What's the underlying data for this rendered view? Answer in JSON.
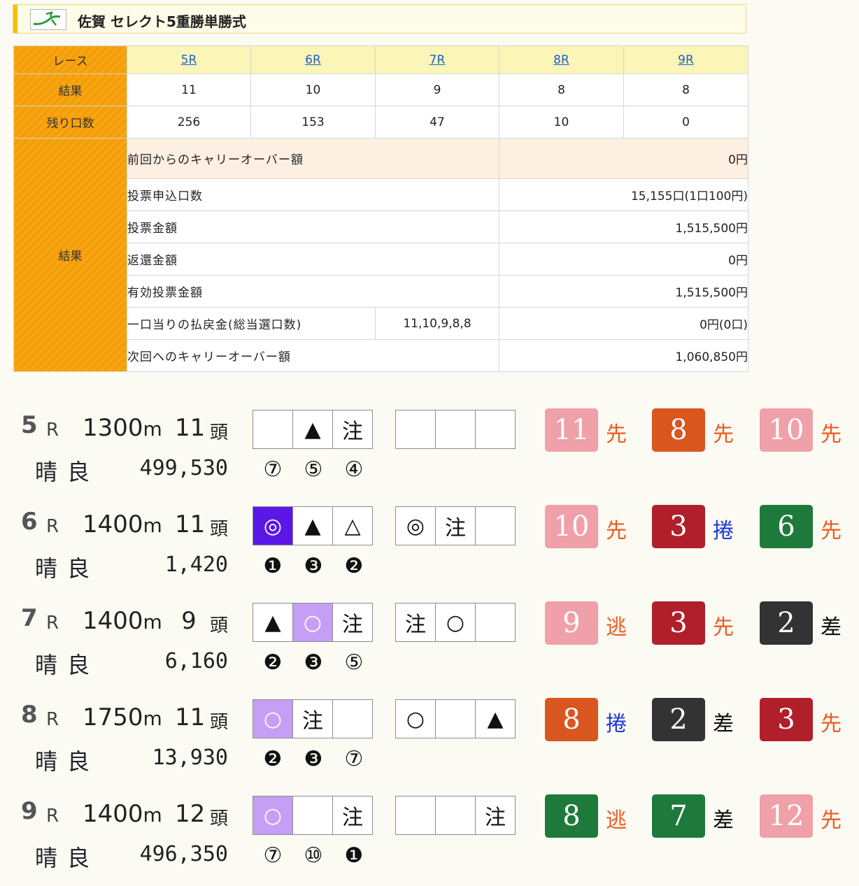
{
  "header": {
    "title": "佐賀 セレクト5重勝単勝式"
  },
  "info": {
    "race_label": "レース",
    "result_label": "結果",
    "remaining_label": "残り口数",
    "races": [
      {
        "name": "5R",
        "result": "11",
        "remaining": "256"
      },
      {
        "name": "6R",
        "result": "10",
        "remaining": "153"
      },
      {
        "name": "7R",
        "result": "9",
        "remaining": "47"
      },
      {
        "name": "8R",
        "result": "8",
        "remaining": "10"
      },
      {
        "name": "9R",
        "result": "8",
        "remaining": "0"
      }
    ],
    "summary_label": "結果",
    "rows": [
      {
        "label": "前回からのキャリーオーバー額",
        "value": "0円"
      },
      {
        "label": "投票申込口数",
        "value": "15,155口(1口100円)"
      },
      {
        "label": "投票金額",
        "value": "1,515,500円"
      },
      {
        "label": "返還金額",
        "value": "0円"
      },
      {
        "label": "有効投票金額",
        "value": "1,515,500円"
      },
      {
        "label": "一口当りの払戻金(総当選口数)",
        "combo": "11,10,9,8,8",
        "value": "0円(0口)"
      },
      {
        "label": "次回へのキャリーオーバー額",
        "value": "1,060,850円"
      }
    ]
  },
  "races": [
    {
      "num": "5",
      "r": "R",
      "dist": "1300",
      "unit": "m",
      "heads": "11",
      "tou": "頭",
      "weather": "晴良",
      "amount": "499,530",
      "marks1": [
        {
          "t": "",
          "bg": ""
        },
        {
          "t": "▲",
          "bg": ""
        },
        {
          "t": "注",
          "bg": ""
        }
      ],
      "marks2": [
        "",
        "",
        ""
      ],
      "circles": [
        "⑦",
        "⑤",
        "④"
      ],
      "horses": [
        {
          "n": "11",
          "color": "#f0a0a8",
          "style": "先",
          "sc": "orange"
        },
        {
          "n": "8",
          "color": "#d9561e",
          "style": "先",
          "sc": "orange"
        },
        {
          "n": "10",
          "color": "#f0a0a8",
          "style": "先",
          "sc": "orange"
        }
      ]
    },
    {
      "num": "6",
      "r": "R",
      "dist": "1400",
      "unit": "m",
      "heads": "11",
      "tou": "頭",
      "weather": "晴良",
      "amount": "1,420",
      "marks1": [
        {
          "t": "◎",
          "bg": "dark"
        },
        {
          "t": "▲",
          "bg": ""
        },
        {
          "t": "△",
          "bg": ""
        }
      ],
      "marks2": [
        "◎",
        "注",
        ""
      ],
      "circles": [
        "❶",
        "❸",
        "❷"
      ],
      "horses": [
        {
          "n": "10",
          "color": "#f0a0a8",
          "style": "先",
          "sc": "orange"
        },
        {
          "n": "3",
          "color": "#b01f2a",
          "style": "捲",
          "sc": "blue"
        },
        {
          "n": "6",
          "color": "#1e7a3a",
          "style": "先",
          "sc": "orange"
        }
      ]
    },
    {
      "num": "7",
      "r": "R",
      "dist": "1400",
      "unit": "m",
      "heads": "9",
      "tou": "頭",
      "weather": "晴良",
      "amount": "6,160",
      "marks1": [
        {
          "t": "▲",
          "bg": ""
        },
        {
          "t": "○",
          "bg": "lav"
        },
        {
          "t": "注",
          "bg": ""
        }
      ],
      "marks2": [
        "注",
        "○",
        ""
      ],
      "circles": [
        "❷",
        "❸",
        "⑤"
      ],
      "horses": [
        {
          "n": "9",
          "color": "#f0a0a8",
          "style": "逃",
          "sc": "orange"
        },
        {
          "n": "3",
          "color": "#b01f2a",
          "style": "先",
          "sc": "orange"
        },
        {
          "n": "2",
          "color": "#333333",
          "style": "差",
          "sc": "black"
        }
      ]
    },
    {
      "num": "8",
      "r": "R",
      "dist": "1750",
      "unit": "m",
      "heads": "11",
      "tou": "頭",
      "weather": "晴良",
      "amount": "13,930",
      "marks1": [
        {
          "t": "○",
          "bg": "lav"
        },
        {
          "t": "注",
          "bg": ""
        },
        {
          "t": "",
          "bg": ""
        }
      ],
      "marks2": [
        "○",
        "",
        "▲"
      ],
      "circles": [
        "❷",
        "❸",
        "⑦"
      ],
      "horses": [
        {
          "n": "8",
          "color": "#d9561e",
          "style": "捲",
          "sc": "blue"
        },
        {
          "n": "2",
          "color": "#333333",
          "style": "差",
          "sc": "black"
        },
        {
          "n": "3",
          "color": "#b01f2a",
          "style": "先",
          "sc": "orange"
        }
      ]
    },
    {
      "num": "9",
      "r": "R",
      "dist": "1400",
      "unit": "m",
      "heads": "12",
      "tou": "頭",
      "weather": "晴良",
      "amount": "496,350",
      "marks1": [
        {
          "t": "○",
          "bg": "lav"
        },
        {
          "t": "",
          "bg": ""
        },
        {
          "t": "注",
          "bg": ""
        }
      ],
      "marks2": [
        "",
        "",
        "注"
      ],
      "circles": [
        "⑦",
        "⑩",
        "❶"
      ],
      "horses": [
        {
          "n": "8",
          "color": "#1e7a3a",
          "style": "逃",
          "sc": "orange"
        },
        {
          "n": "7",
          "color": "#1e7a3a",
          "style": "差",
          "sc": "black"
        },
        {
          "n": "12",
          "color": "#f0a0a8",
          "style": "先",
          "sc": "orange"
        }
      ]
    }
  ]
}
